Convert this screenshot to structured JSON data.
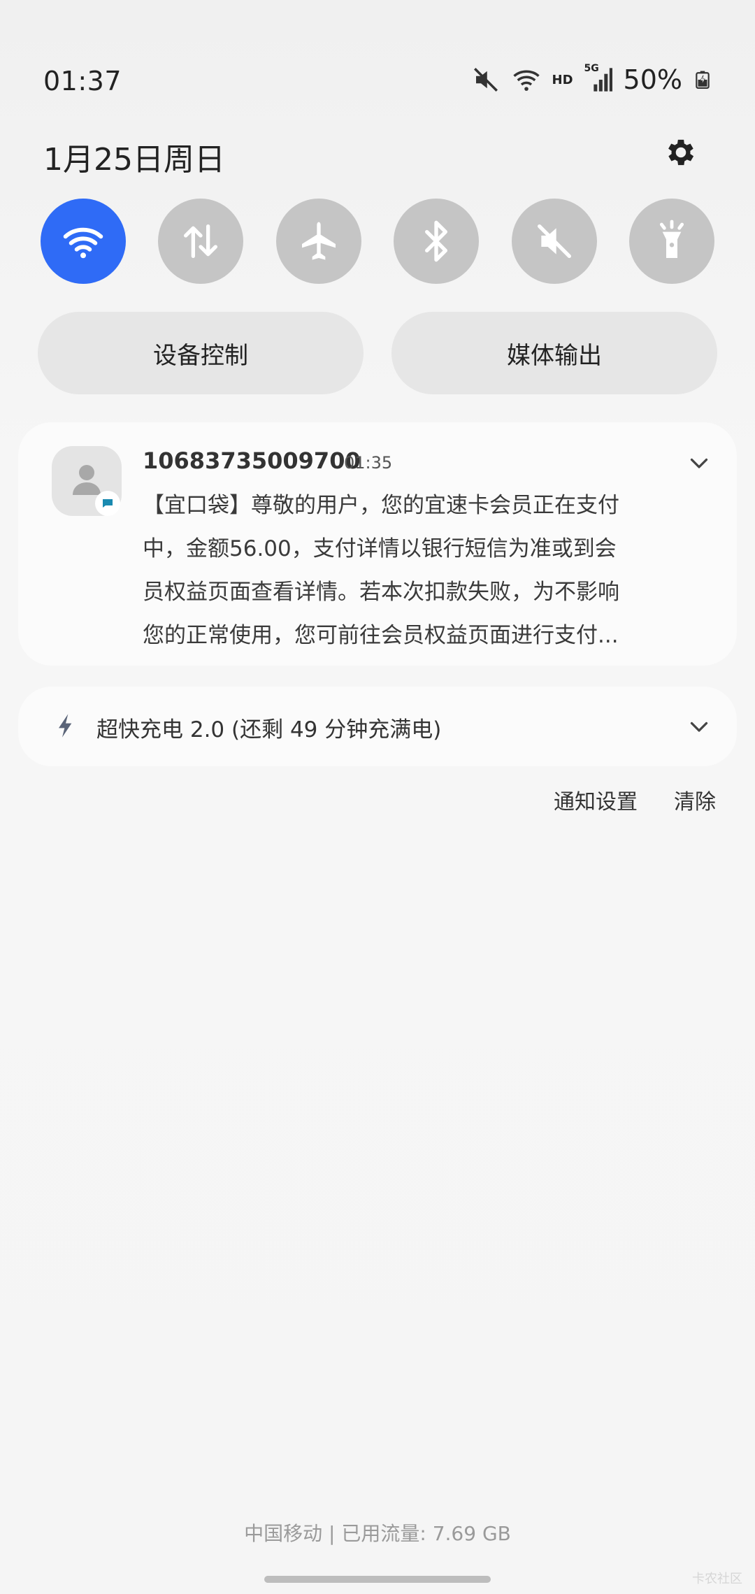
{
  "status_bar": {
    "time": "01:37",
    "date": "1月25日周日",
    "hd_label": "HD",
    "network_label": "5G",
    "battery": "50%",
    "icons": [
      "mute-icon",
      "wifi-icon",
      "signal-icon",
      "battery-charging-icon"
    ]
  },
  "quick_settings": {
    "toggles": [
      {
        "name": "wifi",
        "icon": "wifi-icon",
        "active": true
      },
      {
        "name": "mobile-data",
        "icon": "data-transfer-icon",
        "active": false
      },
      {
        "name": "airplane-mode",
        "icon": "airplane-icon",
        "active": false
      },
      {
        "name": "bluetooth",
        "icon": "bluetooth-icon",
        "active": false
      },
      {
        "name": "mute",
        "icon": "mute-icon",
        "active": false
      },
      {
        "name": "flashlight",
        "icon": "flashlight-icon",
        "active": false
      }
    ],
    "device_control_label": "设备控制",
    "media_output_label": "媒体输出"
  },
  "notifications": {
    "sms": {
      "sender": "10683735009700",
      "time": "01:35",
      "lines": [
        "【宜口袋】尊敬的用户，您的宜速卡会员正在支付",
        "中，金额56.00，支付详情以银行短信为准或到会",
        "员权益页面查看详情。若本次扣款失败，为不影响",
        "您的正常使用，您可前往会员权益页面进行支付..."
      ]
    },
    "charging": {
      "text": "超快充电 2.0 (还剩 49 分钟充满电)"
    },
    "settings_label": "通知设置",
    "clear_label": "清除"
  },
  "footer": {
    "carrier": "中国移动 | 已用流量: 7.69 GB",
    "watermark": "卡农社区"
  },
  "colors": {
    "accent": "#2f6bf6",
    "toggle_inactive": "#c5c5c5",
    "background": "#f5f5f5"
  }
}
